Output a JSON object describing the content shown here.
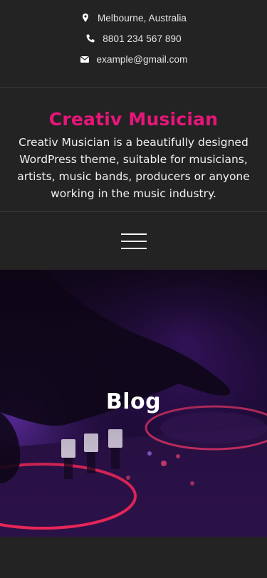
{
  "contact": {
    "location": "Melbourne, Australia",
    "phone": "8801 234 567 890",
    "email": "example@gmail.com",
    "location_icon": "map-marker-icon",
    "phone_icon": "phone-icon",
    "email_icon": "envelope-icon"
  },
  "branding": {
    "site_title": "Creativ Musician",
    "description": "Creativ Musician is a beautifully designed WordPress theme, suitable for musicians, artists, music bands, producers or anyone working in the music industry."
  },
  "nav": {
    "menu_icon": "hamburger-menu-icon"
  },
  "hero": {
    "title": "Blog"
  },
  "colors": {
    "accent": "#e8157a",
    "background": "#232323",
    "text": "#ffffff"
  }
}
